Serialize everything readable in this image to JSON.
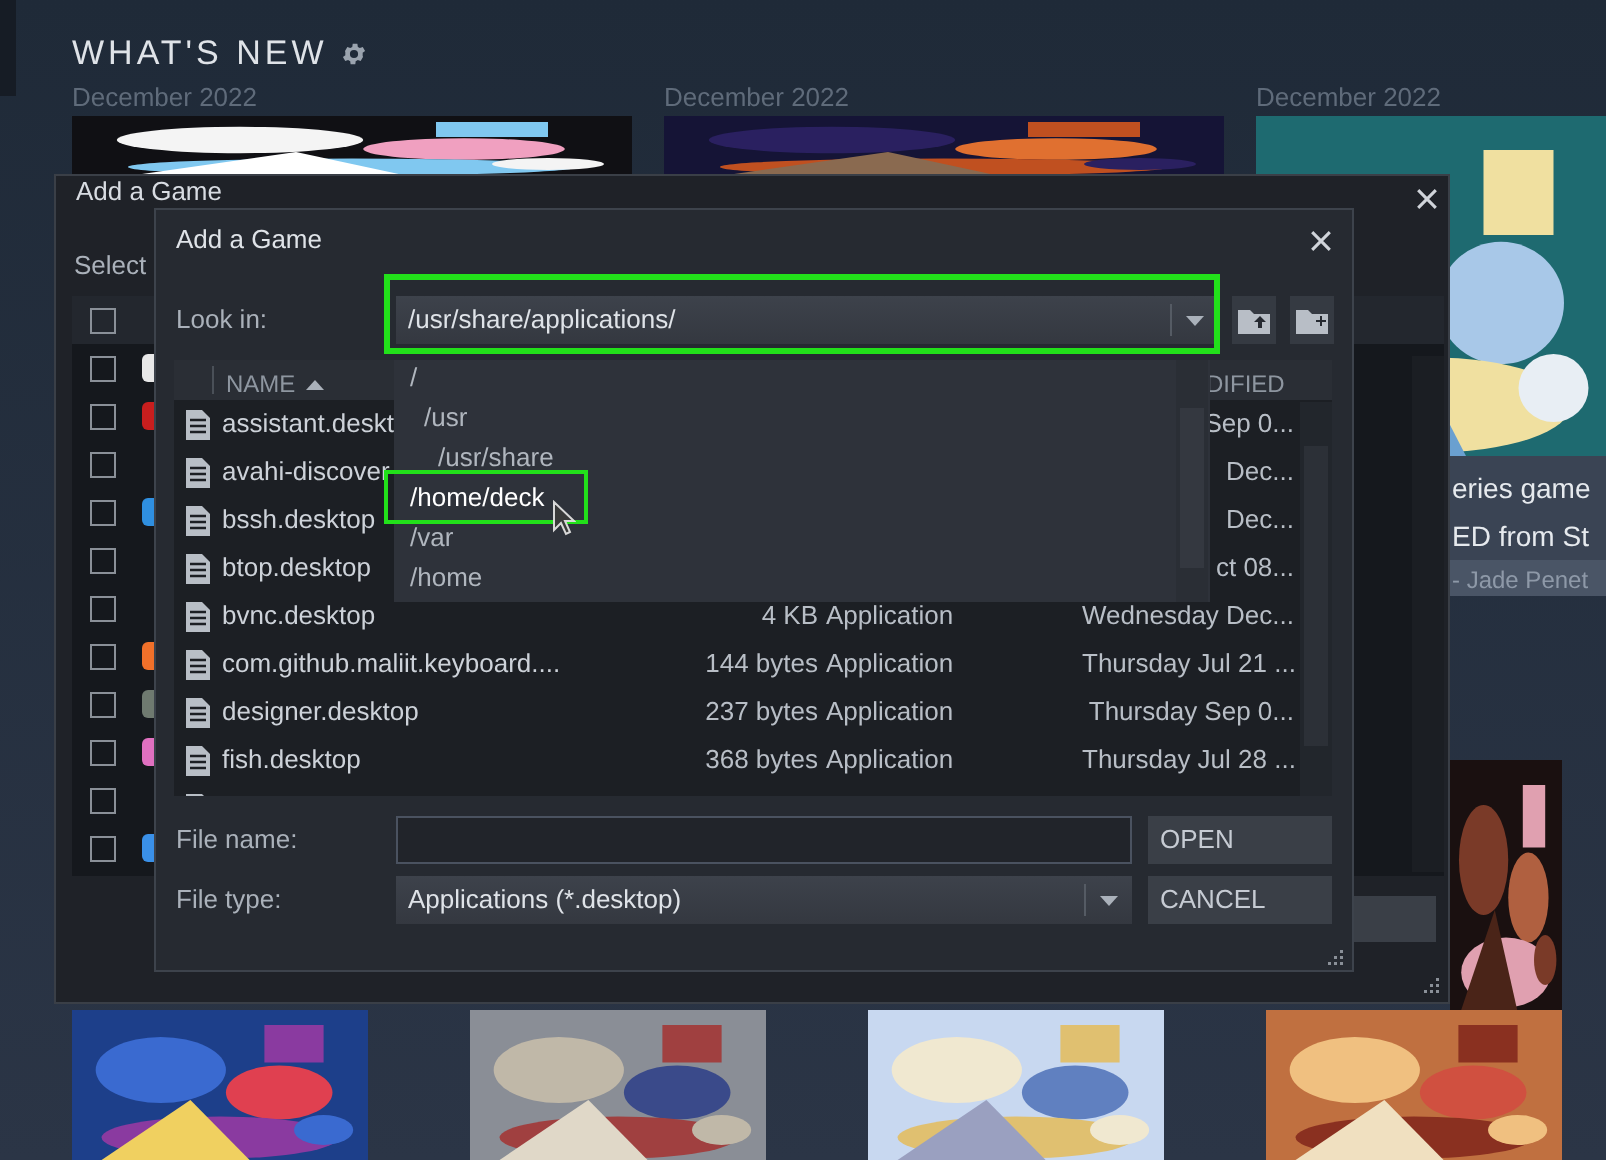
{
  "page": {
    "heading": "WHAT'S NEW",
    "news_dates": [
      "December 2022",
      "December 2022",
      "December 2022"
    ],
    "feature_card": {
      "lines": [
        "eries game",
        "ED from St"
      ],
      "byline": "- Jade Penet"
    }
  },
  "outer_dialog": {
    "title": "Add a Game",
    "subtitle": "Select",
    "rows": [
      {
        "checked": false
      },
      {
        "checked": false,
        "color": "#e8e8e8"
      },
      {
        "checked": false,
        "color": "#c81e1e"
      },
      {
        "checked": false
      },
      {
        "checked": false,
        "color": "#2f8fe0"
      },
      {
        "checked": false
      },
      {
        "checked": false
      },
      {
        "checked": false,
        "color": "#f0702a"
      },
      {
        "checked": false,
        "color": "#6f7a70"
      },
      {
        "checked": false,
        "color": "#e070c0"
      },
      {
        "checked": false
      },
      {
        "checked": false,
        "color": "#3a90e8"
      }
    ]
  },
  "file_dialog": {
    "title": "Add a Game",
    "look_in": {
      "label": "Look in:",
      "value": "/usr/share/applications/",
      "highlighted": true
    },
    "columns": [
      {
        "label": "NAME",
        "sorted": true
      },
      {
        "label": "DIFIED",
        "sorted": false
      }
    ],
    "files": [
      {
        "kind": "file",
        "name": "assistant.deskt",
        "modified": "Sep 0..."
      },
      {
        "kind": "file",
        "name": "avahi-discover",
        "modified": "Dec..."
      },
      {
        "kind": "file",
        "name": "bssh.desktop",
        "modified": "Dec..."
      },
      {
        "kind": "file",
        "name": "btop.desktop",
        "modified": "ct 08..."
      },
      {
        "kind": "file",
        "name": "bvnc.desktop",
        "size": "4 KB",
        "type": "Application",
        "modified": "Wednesday Dec..."
      },
      {
        "kind": "file",
        "name": "com.github.maliit.keyboard....",
        "size": "144 bytes",
        "type": "Application",
        "modified": "Thursday Jul 21 ..."
      },
      {
        "kind": "file",
        "name": "designer.desktop",
        "size": "237 bytes",
        "type": "Application",
        "modified": "Thursday Sep 0..."
      },
      {
        "kind": "file",
        "name": "fish.desktop",
        "size": "368 bytes",
        "type": "Application",
        "modified": "Thursday Jul 28 ..."
      },
      {
        "kind": "cut"
      }
    ],
    "file_name": {
      "label": "File name:"
    },
    "file_type": {
      "label": "File type:",
      "value": "Applications (*.desktop)"
    },
    "buttons": [
      "OPEN",
      "CANCEL"
    ],
    "dropdown": {
      "items": [
        {
          "label": "/",
          "selected": false,
          "children": [
            {
              "label": "/usr",
              "selected": false,
              "children": [
                {
                  "label": "/usr/share",
                  "selected": false
                }
              ]
            }
          ]
        },
        {
          "label": "/home/deck",
          "selected": true,
          "highlighted": true
        },
        {
          "label": "/var",
          "selected": false
        },
        {
          "label": "/home",
          "selected": false
        }
      ]
    }
  }
}
